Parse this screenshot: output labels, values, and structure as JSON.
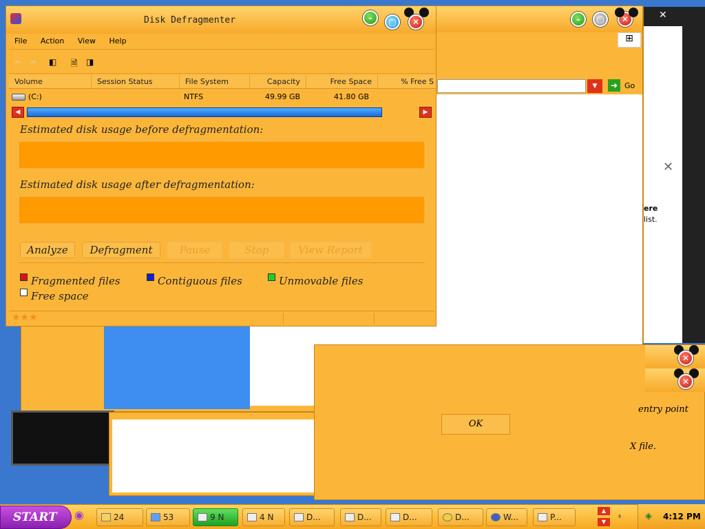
{
  "window": {
    "title": "Disk Defragmenter"
  },
  "menu": [
    "File",
    "Action",
    "View",
    "Help"
  ],
  "columns": [
    "Volume",
    "Session Status",
    "File System",
    "Capacity",
    "Free Space",
    "% Free S"
  ],
  "volumes": [
    {
      "volume": "(C:)",
      "status": "",
      "file_system": "NTFS",
      "capacity": "49.99 GB",
      "free_space": "41.80 GB"
    }
  ],
  "labels": {
    "before": "Estimated disk usage before defragmentation:",
    "after": "Estimated disk usage after defragmentation:"
  },
  "buttons": {
    "analyze": "Analyze",
    "defragment": "Defragment",
    "pause": "Pause",
    "stop": "Stop",
    "view_report": "View Report"
  },
  "legend": {
    "fragmented": "Fragmented files",
    "contiguous": "Contiguous files",
    "unmovable": "Unmovable files",
    "free": "Free space"
  },
  "colors": {
    "fragmented": "#e01010",
    "contiguous": "#1020d0",
    "unmovable": "#20d020",
    "free": "#ffffff"
  },
  "background": {
    "go_label": "Go",
    "side_text_1": "ere",
    "side_text_2": "list.",
    "dialog_ok": "OK",
    "dialog_text_1": "entry point",
    "dialog_text_2": "X file."
  },
  "taskbar": {
    "start": "START",
    "tasks": [
      "24",
      "53",
      "9 N",
      "4 N",
      "D...",
      "D...",
      "D...",
      "D...",
      "W...",
      "P..."
    ],
    "clock": "4:12 PM"
  }
}
